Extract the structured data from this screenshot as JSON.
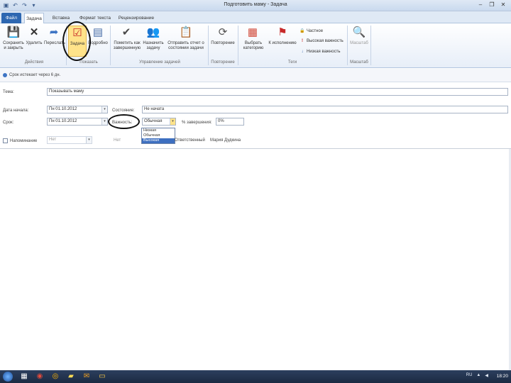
{
  "window": {
    "title": "Подготовить маму - Задача",
    "qat_icons": [
      "save-icon",
      "undo-icon",
      "redo-icon",
      "dropdown-icon"
    ],
    "controls": [
      "minimize",
      "restore",
      "close"
    ]
  },
  "tabs": {
    "file": "Файл",
    "task": "Задача",
    "insert": "Вставка",
    "format_text": "Формат текста",
    "review": "Рецензирование"
  },
  "ribbon": {
    "save_close": "Сохранить и закрыть",
    "delete": "Удалить",
    "forward": "Переслать",
    "task_btn": "Задача",
    "details": "Подробно",
    "mark_complete": "Пометить как завершенную",
    "assign_task": "Назначить задачу",
    "send_status": "Отправить отчет о состоянии задачи",
    "recurrence": "Повторение",
    "categorize": "Выбрать категорию",
    "follow_up": "К исполнению",
    "private": "Частное",
    "high_importance": "Высокая важность",
    "low_importance": "Низкая важность",
    "zoom": "Масштаб",
    "groups": {
      "actions": "Действия",
      "show": "Показать",
      "manage_task": "Управление задачей",
      "recurrence": "Повторение",
      "tags": "Теги",
      "zoom": "Масштаб"
    }
  },
  "info_bar": {
    "text": "Срок истекает через 6 дн."
  },
  "form": {
    "subject_label": "Тема:",
    "subject_value": "Показывать маму",
    "start_label": "Дата начала:",
    "start_value": "Пн 01.10.2012",
    "due_label": "Срок:",
    "due_value": "Пн 01.10.2012",
    "status_label": "Состояние:",
    "status_value": "Не начата",
    "priority_label": "Важность:",
    "priority_value": "Обычная",
    "percent_label": "% завершения:",
    "percent_value": "0%",
    "reminder_label": "Напоминание",
    "reminder_value": "Нет",
    "reminder_time": "Нет",
    "owner_label": "Ответственный",
    "owner_value": "Мария Дудкина",
    "priority_options": [
      "Низкая",
      "Обычная",
      "Высокая"
    ],
    "priority_selected_index": 2
  },
  "taskbar": {
    "lang": "RU",
    "time": "18:20"
  }
}
